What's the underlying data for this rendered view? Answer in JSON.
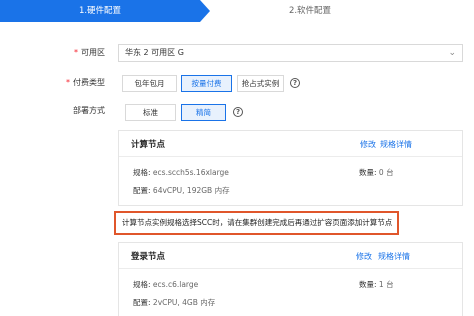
{
  "tabs": [
    "1.硬件配置",
    "2.软件配置"
  ],
  "form": {
    "zone_label": "可用区",
    "zone_value": "华东 2 可用区 G",
    "billing_label": "付费类型",
    "billing_options": [
      "包年包月",
      "按量付费",
      "抢占式实例"
    ],
    "billing_selected": "按量付费",
    "deploy_label": "部署方式",
    "deploy_options": [
      "标准",
      "精简"
    ],
    "deploy_selected": "精简"
  },
  "compute_card": {
    "title": "计算节点",
    "edit": "修改",
    "details": "规格详情",
    "spec_label": "规格:",
    "spec_value": "ecs.scch5s.16xlarge",
    "qty_label": "数量:",
    "qty_value": "0 台",
    "config_label": "配置:",
    "config_value": "64vCPU, 192GB 内存"
  },
  "notice": "计算节点实例规格选择SCC时，请在集群创建完成后再通过扩容页面添加计算节点",
  "login_card": {
    "title": "登录节点",
    "edit": "修改",
    "details": "规格详情",
    "spec_label": "规格:",
    "spec_value": "ecs.c6.large",
    "qty_label": "数量:",
    "qty_value": "1 台",
    "config_label": "配置:",
    "config_value": "2vCPU, 4GB 内存"
  },
  "colors": {
    "accent": "#1a73e8",
    "notice_border": "#e0562b",
    "required": "#f5222d"
  },
  "icons": [
    "help-icon",
    "chevron-down-icon"
  ]
}
